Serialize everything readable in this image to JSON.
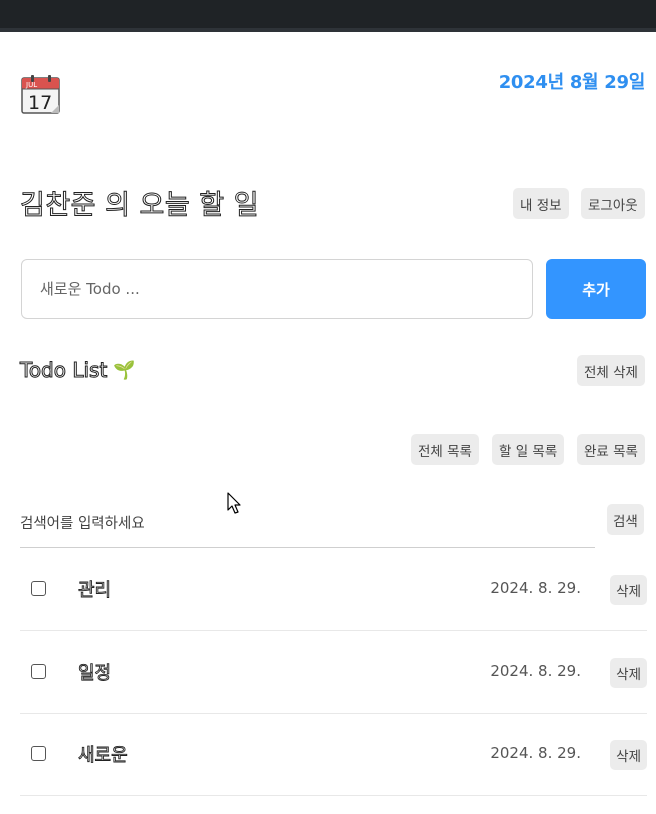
{
  "header": {
    "calendar_month": "JUL",
    "calendar_day": "17",
    "date": "2024년 8월 29일"
  },
  "user": {
    "title": "김찬준 의 오늘 할 일",
    "my_info_label": "내 정보",
    "logout_label": "로그아웃"
  },
  "new_todo": {
    "placeholder": "새로운 Todo ...",
    "add_label": "추가"
  },
  "list": {
    "title": "Todo List",
    "emoji": "🌱",
    "delete_all_label": "전체 삭제",
    "filters": [
      "전체 목록",
      "할 일 목록",
      "완료 목록"
    ]
  },
  "search": {
    "placeholder": "검색어를 입력하세요",
    "button_label": "검색"
  },
  "todos": [
    {
      "text": "관리",
      "date": "2024. 8. 29.",
      "delete_label": "삭제",
      "done": false
    },
    {
      "text": "일정",
      "date": "2024. 8. 29.",
      "delete_label": "삭제",
      "done": false
    },
    {
      "text": "새로운",
      "date": "2024. 8. 29.",
      "delete_label": "삭제",
      "done": false
    }
  ],
  "colors": {
    "accent": "#3395ff",
    "date": "#2f8ff0",
    "topbar": "#1f2326"
  }
}
